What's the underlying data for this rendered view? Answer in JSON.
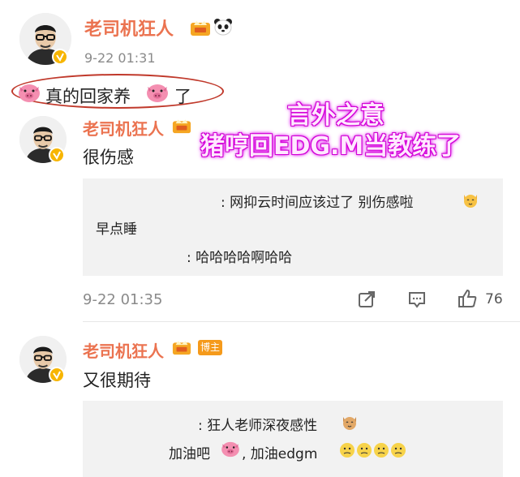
{
  "comment1": {
    "username": "老司机狂人",
    "time": "9-22 01:31",
    "text_a": "真的回家养",
    "text_b": "了"
  },
  "overlay": {
    "line1": "言外之意",
    "line2": "猪哼回EDG.M当教练了"
  },
  "comment2": {
    "username": "老司机狂人",
    "text": "很伤感",
    "replies": [
      ": 网抑云时间应该过了  别伤感啦",
      "早点睡",
      ": 哈哈哈哈啊哈哈"
    ],
    "time": "9-22 01:35",
    "like_count": "76"
  },
  "comment3": {
    "username": "老司机狂人",
    "badge": "博主",
    "text": "又很期待",
    "replies": [
      ": 狂人老师深夜感性",
      "加油吧",
      ", 加油edgm"
    ]
  },
  "colors": {
    "username": "#eb7350",
    "verify": "#f7b500",
    "reply_bg": "#f2f2f2",
    "badge": "#f59a1b"
  },
  "icons": [
    "pig-emoji",
    "crown-icon",
    "panda-emoji",
    "verified-icon",
    "share-icon",
    "comment-icon",
    "like-icon",
    "cat-emoji",
    "dizzy-face-emoji"
  ]
}
